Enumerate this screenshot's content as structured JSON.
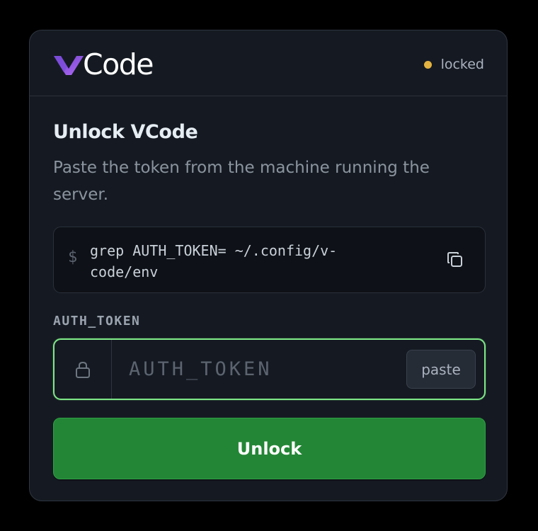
{
  "header": {
    "logo_text": "Code",
    "logo_icon": "v-logo-icon",
    "status": {
      "label": "locked",
      "dot_color": "#e3b341"
    }
  },
  "main": {
    "title": "Unlock VCode",
    "subtitle": "Paste the token from the machine running the server."
  },
  "command": {
    "prompt": "$",
    "text": "grep AUTH_TOKEN= ~/.config/v-code/env",
    "copy_icon": "copy-icon"
  },
  "token_field": {
    "label": "AUTH_TOKEN",
    "placeholder": "AUTH_TOKEN",
    "value": "",
    "lock_icon": "lock-icon",
    "paste_label": "paste"
  },
  "unlock_button": {
    "label": "Unlock"
  },
  "colors": {
    "background": "#000000",
    "card": "#151a22",
    "accent_green": "#238636",
    "focus_border": "#7ee787",
    "logo_gradient_start": "#6e40c9",
    "logo_gradient_end": "#b06bf5"
  }
}
